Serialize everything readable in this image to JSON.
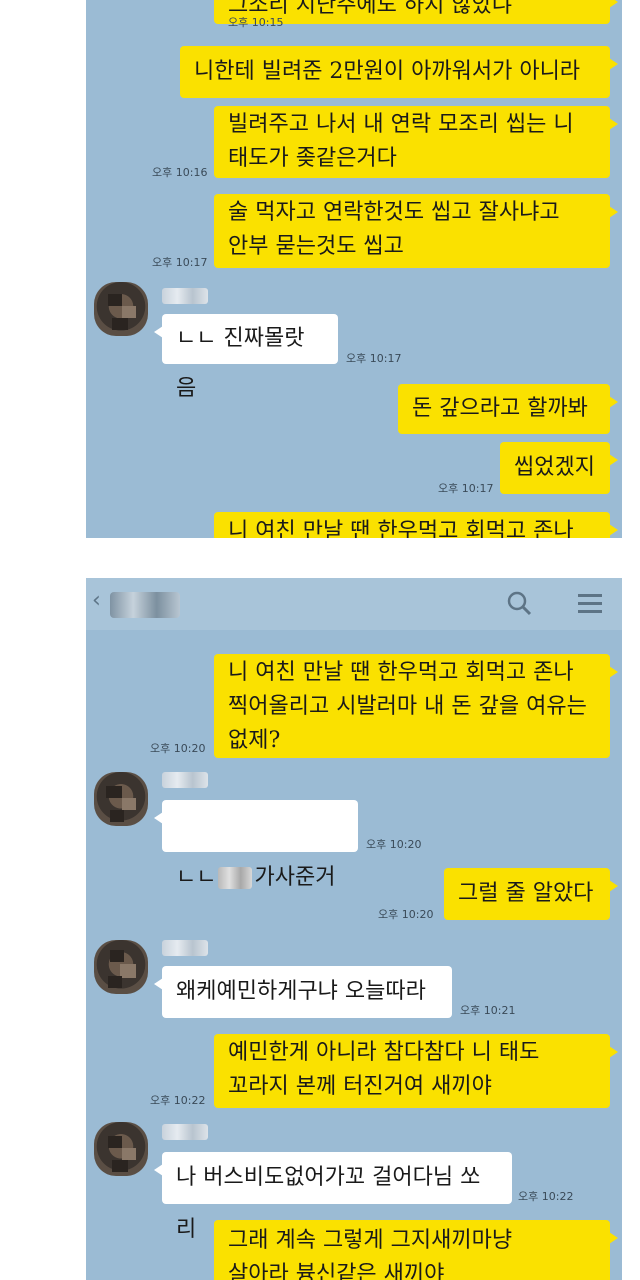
{
  "screen1": {
    "messages": [
      {
        "id": "m0",
        "from": "me",
        "text": "그소리 지난주에도 하지 않았냐",
        "time": "오후 10:15"
      },
      {
        "id": "m1",
        "from": "me",
        "text": "니한테 빌려준 2만원이 아까워서가 아니라",
        "time": ""
      },
      {
        "id": "m2",
        "from": "me",
        "text": "빌려주고 나서 내 연락 모조리 씹는 니\n태도가 좆같은거다",
        "time": "오후 10:16"
      },
      {
        "id": "m3",
        "from": "me",
        "text": "술 먹자고 연락한것도 씹고 잘사냐고\n안부 묻는것도 씹고",
        "time": "오후 10:17"
      },
      {
        "id": "m4",
        "from": "them",
        "text": "ㄴㄴ 진짜몰랏음",
        "time": "오후 10:17"
      },
      {
        "id": "m5",
        "from": "me",
        "text": "돈 갚으라고 할까봐",
        "time": ""
      },
      {
        "id": "m6",
        "from": "me",
        "text": "씹었겠지",
        "time": "오후 10:17"
      },
      {
        "id": "m7",
        "from": "me",
        "text": "니 여친 만날 땐 한우먹고 회먹고 존나",
        "time": ""
      }
    ]
  },
  "screen2": {
    "header": {
      "back_icon": "chevron-left-icon",
      "search_icon": "search-icon",
      "menu_icon": "menu-icon"
    },
    "messages": [
      {
        "id": "n0",
        "from": "me",
        "text": "니 여친 만날 땐 한우먹고 회먹고 존나\n찍어올리고 시발러마 내 돈 갚을 여유는\n없제?",
        "time": "오후 10:20"
      },
      {
        "id": "n1",
        "from": "them",
        "text_before": "ㄴㄴ",
        "text_after": "가사준거",
        "time": "오후 10:20"
      },
      {
        "id": "n2",
        "from": "me",
        "text": "그럴 줄 알았다",
        "time": "오후 10:20"
      },
      {
        "id": "n3",
        "from": "them",
        "text": "왜케예민하게구냐 오늘따라",
        "time": "오후 10:21"
      },
      {
        "id": "n4",
        "from": "me",
        "text": "예민한게 아니라 참다참다 니 태도\n꼬라지 본께 터진거여 새끼야",
        "time": "오후 10:22"
      },
      {
        "id": "n5",
        "from": "them",
        "text": "나 버스비도없어가꼬 걸어다님 쏘리",
        "time": "오후 10:22"
      },
      {
        "id": "n6",
        "from": "me",
        "text": "그래 계속 그렇게 그지새끼마냥\n살아라 븅신같은 새끼야",
        "time": ""
      }
    ]
  },
  "colors": {
    "chat_bg": "#9bbbd4",
    "my_bubble": "#fae100",
    "their_bubble": "#ffffff"
  }
}
